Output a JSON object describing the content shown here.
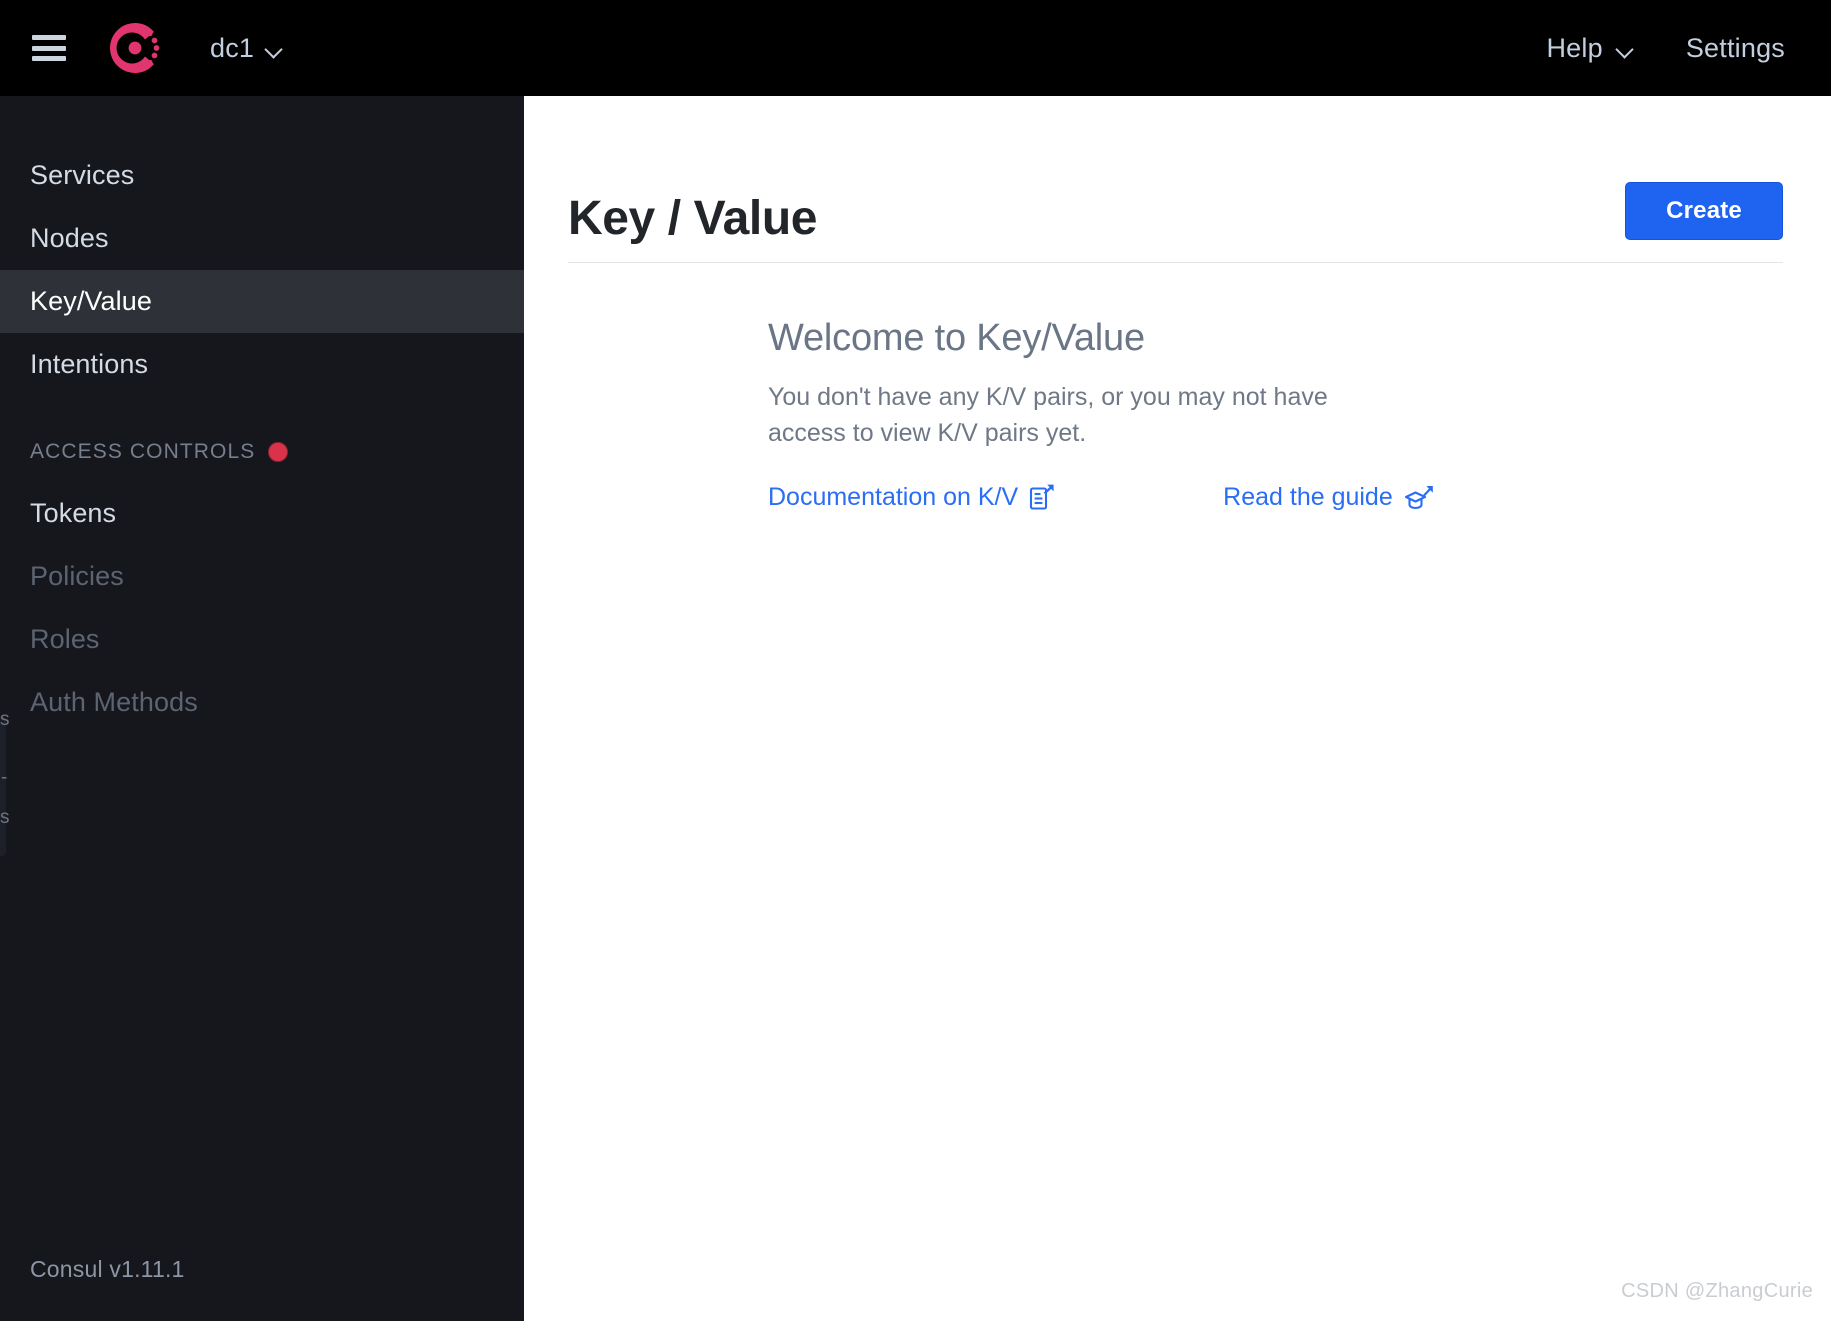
{
  "header": {
    "menu_icon": "hamburger-icon",
    "logo_icon": "consul-logo-icon",
    "datacenter_label": "dc1",
    "datacenter_chevron_icon": "chevron-down-icon",
    "help_label": "Help",
    "help_chevron_icon": "chevron-down-icon",
    "settings_label": "Settings",
    "background_color": "#000000",
    "text_color": "#c3cede"
  },
  "sidebar": {
    "background_color": "#15171c",
    "active_background_color": "#2e3138",
    "items": [
      {
        "label": "Services",
        "state": "enabled"
      },
      {
        "label": "Nodes",
        "state": "enabled"
      },
      {
        "label": "Key/Value",
        "state": "active"
      },
      {
        "label": "Intentions",
        "state": "enabled"
      }
    ],
    "section": {
      "label": "ACCESS CONTROLS",
      "badge_icon": "red-dot-badge",
      "badge_color": "#d8334a"
    },
    "acl_items": [
      {
        "label": "Tokens",
        "state": "enabled"
      },
      {
        "label": "Policies",
        "state": "disabled"
      },
      {
        "label": "Roles",
        "state": "disabled"
      },
      {
        "label": "Auth Methods",
        "state": "disabled"
      }
    ],
    "ghost_fragments": [
      "s",
      "-",
      "s"
    ],
    "footer_version": "Consul v1.11.1"
  },
  "main": {
    "page_title": "Key / Value",
    "create_button_label": "Create",
    "create_button_color": "#1f64f0",
    "empty_state": {
      "title": "Welcome to Key/Value",
      "body": "You don't have any K/V pairs, or you may not have access to view K/V pairs yet.",
      "links": [
        {
          "label": "Documentation on K/V",
          "icon": "document-external-link-icon"
        },
        {
          "label": "Read the guide",
          "icon": "graduation-cap-external-link-icon"
        }
      ],
      "link_color": "#2a6ef5"
    }
  },
  "watermark": {
    "text": "CSDN @ZhangCurie"
  }
}
